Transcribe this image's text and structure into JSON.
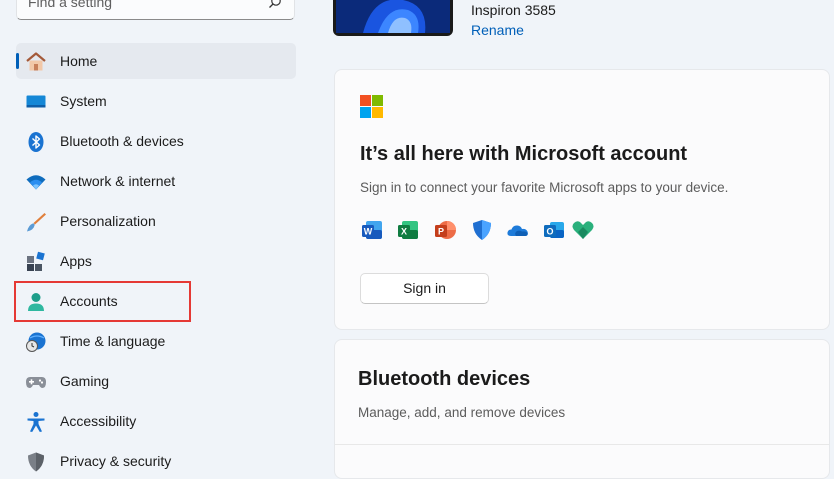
{
  "search": {
    "placeholder": "Find a setting"
  },
  "sidebar": {
    "items": [
      {
        "label": "Home",
        "icon": "home-icon",
        "active": true
      },
      {
        "label": "System",
        "icon": "system-icon"
      },
      {
        "label": "Bluetooth & devices",
        "icon": "bluetooth-icon"
      },
      {
        "label": "Network & internet",
        "icon": "wifi-icon"
      },
      {
        "label": "Personalization",
        "icon": "paintbrush-icon"
      },
      {
        "label": "Apps",
        "icon": "apps-icon"
      },
      {
        "label": "Accounts",
        "icon": "person-icon",
        "highlighted": true
      },
      {
        "label": "Time & language",
        "icon": "globe-clock-icon"
      },
      {
        "label": "Gaming",
        "icon": "gamepad-icon"
      },
      {
        "label": "Accessibility",
        "icon": "accessibility-icon"
      },
      {
        "label": "Privacy & security",
        "icon": "shield-icon"
      }
    ]
  },
  "device": {
    "name": "Inspiron 3585",
    "rename_label": "Rename"
  },
  "ms_account_card": {
    "title": "It’s all here with Microsoft account",
    "subtitle": "Sign in to connect your favorite Microsoft apps to your device.",
    "apps": [
      "word-icon",
      "excel-icon",
      "powerpoint-icon",
      "defender-icon",
      "onedrive-icon",
      "outlook-icon",
      "family-icon"
    ],
    "signin_label": "Sign in"
  },
  "bluetooth_card": {
    "title": "Bluetooth devices",
    "subtitle": "Manage, add, and remove devices"
  },
  "colors": {
    "accent": "#005fb8",
    "highlight_box": "#e53935",
    "background": "#f0f4f9"
  }
}
